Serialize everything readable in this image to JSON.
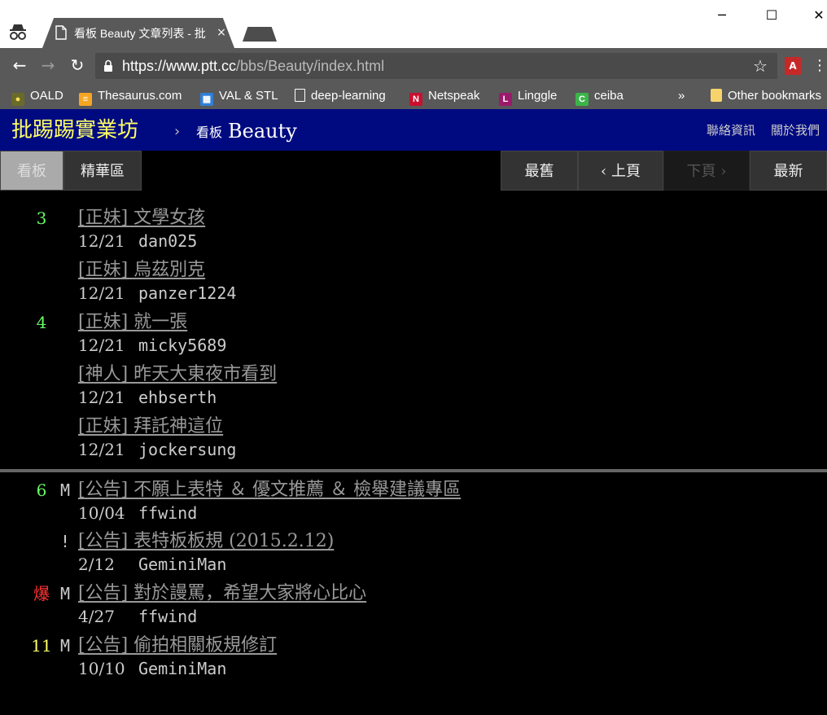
{
  "browser": {
    "tab_title": "看板 Beauty 文章列表 - 批",
    "tab_close": "×",
    "window_controls": {
      "minimize": "─",
      "maximize": "☐",
      "close": "✕"
    },
    "url_host": "https://www.ptt.cc",
    "url_path": "/bbs/Beauty/index.html",
    "bookmarks": [
      {
        "label": "OALD",
        "icon": "oald-icon"
      },
      {
        "label": "Thesaurus.com",
        "icon": "thesaurus-icon"
      },
      {
        "label": "VAL & STL",
        "icon": "val-stl-icon"
      },
      {
        "label": "deep-learning",
        "icon": "page-icon"
      },
      {
        "label": "Netspeak",
        "icon": "netspeak-icon"
      },
      {
        "label": "Linggle",
        "icon": "linggle-icon"
      },
      {
        "label": "ceiba",
        "icon": "ceiba-icon"
      }
    ],
    "bookmarks_overflow": "»",
    "other_bookmarks": "Other bookmarks"
  },
  "header": {
    "logo": "批踢踢實業坊",
    "separator": "›",
    "board_prefix": "看板",
    "board_name": "Beauty",
    "contact": "聯絡資訊",
    "about": "關於我們"
  },
  "nav": {
    "board": "看板",
    "digest": "精華區",
    "oldest": "最舊",
    "prev": "‹ 上頁",
    "next": "下頁 ›",
    "newest": "最新"
  },
  "posts": [
    {
      "push": "3",
      "push_color": "#66ff66",
      "mark": "",
      "title": "[正妹] 文學女孩",
      "date": "12/21",
      "author": "dan025"
    },
    {
      "push": "",
      "push_color": "#66ff66",
      "mark": "",
      "title": "[正妹] 烏茲別克",
      "date": "12/21",
      "author": "panzer1224"
    },
    {
      "push": "4",
      "push_color": "#66ff66",
      "mark": "",
      "title": "[正妹] 就一張",
      "date": "12/21",
      "author": "micky5689"
    },
    {
      "push": "",
      "push_color": "#66ff66",
      "mark": "",
      "title": "[神人] 昨天大東夜市看到",
      "date": "12/21",
      "author": "ehbserth"
    },
    {
      "push": "",
      "push_color": "#66ff66",
      "mark": "",
      "title": "[正妹] 拜託神這位",
      "date": "12/21",
      "author": "jockersung"
    }
  ],
  "pinned": [
    {
      "push": "6",
      "push_color": "#66ff66",
      "mark": "M",
      "title": "[公告] 不願上表特 ＆ 優文推薦 ＆ 檢舉建議專區",
      "date": "10/04",
      "author": "ffwind"
    },
    {
      "push": "",
      "push_color": "#66ff66",
      "mark": "!",
      "title": "[公告] 表特板板規 (2015.2.12)",
      "date": "2/12",
      "author": "GeminiMan"
    },
    {
      "push": "爆",
      "push_color": "#ff3333",
      "mark": "M",
      "title": "[公告] 對於謾罵，希望大家將心比心",
      "date": "4/27",
      "author": "ffwind"
    },
    {
      "push": "11",
      "push_color": "#ffff66",
      "mark": "M",
      "title": "[公告] 偷拍相關板規修訂",
      "date": "10/10",
      "author": "GeminiMan"
    }
  ]
}
